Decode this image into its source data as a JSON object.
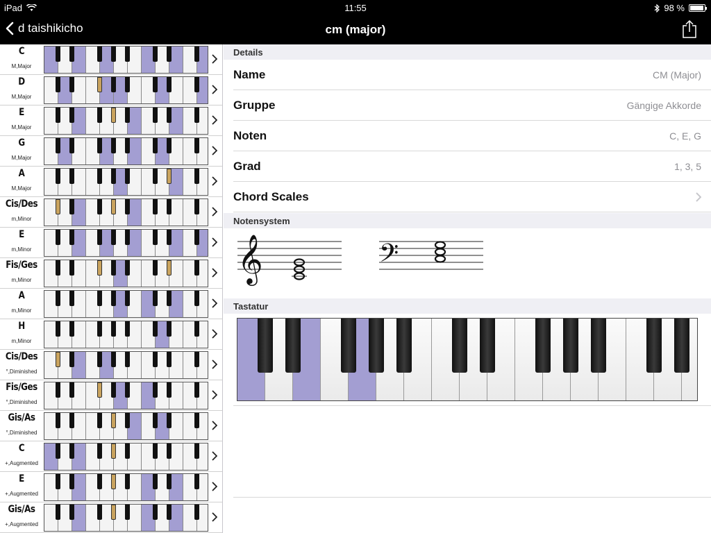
{
  "status_bar": {
    "device": "iPad",
    "time": "11:55",
    "battery": "98 %"
  },
  "nav": {
    "back_label": "d taishikicho",
    "title": "cm (major)"
  },
  "chord_list": [
    {
      "name": "C",
      "type": "M,Major",
      "white_hl": [
        0,
        2,
        4,
        7,
        9,
        11
      ],
      "black_hl": []
    },
    {
      "name": "D",
      "type": "M,Major",
      "white_hl": [
        1,
        4,
        5,
        8,
        11
      ],
      "black_hl": [
        2
      ]
    },
    {
      "name": "E",
      "type": "M,Major",
      "white_hl": [
        2,
        6,
        9
      ],
      "black_hl": [
        3
      ]
    },
    {
      "name": "G",
      "type": "M,Major",
      "white_hl": [
        1,
        4,
        6,
        8
      ],
      "black_hl": []
    },
    {
      "name": "A",
      "type": "M,Major",
      "white_hl": [
        5,
        9
      ],
      "black_hl": [
        6
      ]
    },
    {
      "name": "Cis/Des",
      "type": "m,Minor",
      "white_hl": [
        2,
        6
      ],
      "black_hl": [
        0,
        3
      ]
    },
    {
      "name": "E",
      "type": "m,Minor",
      "white_hl": [
        2,
        4,
        6,
        9,
        11
      ],
      "black_hl": []
    },
    {
      "name": "Fis/Ges",
      "type": "m,Minor",
      "white_hl": [
        5
      ],
      "black_hl": [
        2,
        6
      ]
    },
    {
      "name": "A",
      "type": "m,Minor",
      "white_hl": [
        5,
        7,
        9
      ],
      "black_hl": []
    },
    {
      "name": "H",
      "type": "m,Minor",
      "white_hl": [
        8
      ],
      "black_hl": [
        9
      ]
    },
    {
      "name": "Cis/Des",
      "type": "°,Diminished",
      "white_hl": [
        2,
        4
      ],
      "black_hl": [
        0
      ]
    },
    {
      "name": "Fis/Ges",
      "type": "°,Diminished",
      "white_hl": [
        5,
        7
      ],
      "black_hl": [
        2
      ]
    },
    {
      "name": "Gis/As",
      "type": "°,Diminished",
      "white_hl": [
        6,
        8
      ],
      "black_hl": [
        3
      ]
    },
    {
      "name": "C",
      "type": "+,Augmented",
      "white_hl": [
        0,
        2
      ],
      "black_hl": [
        3
      ]
    },
    {
      "name": "E",
      "type": "+,Augmented",
      "white_hl": [
        2,
        7,
        9
      ],
      "black_hl": [
        3
      ]
    },
    {
      "name": "Gis/As",
      "type": "+,Augmented",
      "white_hl": [
        2,
        7,
        9
      ],
      "black_hl": [
        3
      ]
    }
  ],
  "details": {
    "header": "Details",
    "rows": [
      {
        "label": "Name",
        "value": "CM (Major)"
      },
      {
        "label": "Gruppe",
        "value": "Gängige Akkorde"
      },
      {
        "label": "Noten",
        "value": "C, E, G"
      },
      {
        "label": "Grad",
        "value": "1, 3, 5"
      },
      {
        "label": "Chord Scales",
        "value": ""
      }
    ]
  },
  "notensystem_header": "Notensystem",
  "tastatur_header": "Tastatur",
  "keyboard_highlight_white": [
    0,
    2,
    4
  ],
  "colors": {
    "highlight": "#a39ed2",
    "gold_key": "#c9a35e"
  }
}
